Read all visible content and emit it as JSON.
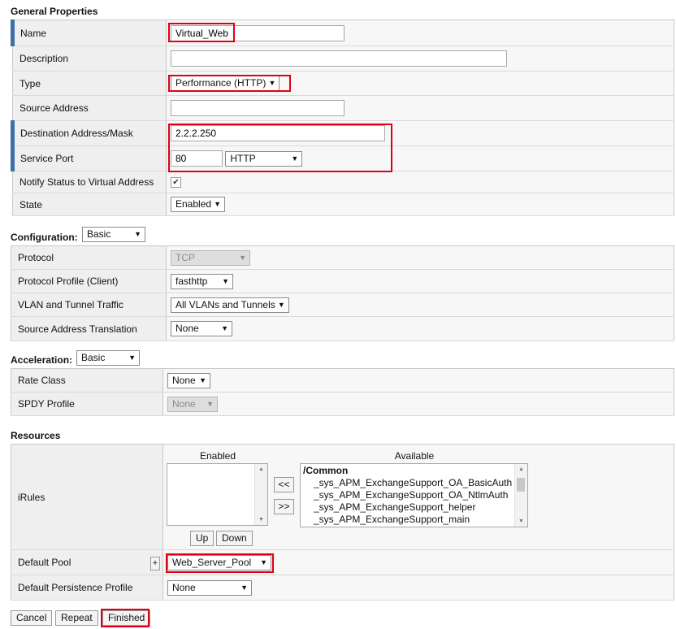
{
  "general": {
    "title": "General Properties",
    "name_label": "Name",
    "name_value": "Virtual_Web",
    "description_label": "Description",
    "description_value": "",
    "type_label": "Type",
    "type_value": "Performance (HTTP)",
    "source_label": "Source Address",
    "source_value": "",
    "dest_label": "Destination Address/Mask",
    "dest_value": "2.2.2.250",
    "port_label": "Service Port",
    "port_value": "80",
    "port_service": "HTTP",
    "notify_label": "Notify Status to Virtual Address",
    "notify_checked": "✔",
    "state_label": "State",
    "state_value": "Enabled"
  },
  "configuration": {
    "title": "Configuration:",
    "mode": "Basic",
    "protocol_label": "Protocol",
    "protocol_value": "TCP",
    "profile_label": "Protocol Profile (Client)",
    "profile_value": "fasthttp",
    "vlan_label": "VLAN and Tunnel Traffic",
    "vlan_value": "All VLANs and Tunnels",
    "snat_label": "Source Address Translation",
    "snat_value": "None"
  },
  "acceleration": {
    "title": "Acceleration:",
    "mode": "Basic",
    "rate_label": "Rate Class",
    "rate_value": "None",
    "spdy_label": "SPDY Profile",
    "spdy_value": "None"
  },
  "resources": {
    "title": "Resources",
    "irules_label": "iRules",
    "enabled_header": "Enabled",
    "available_header": "Available",
    "move_left": "<<",
    "move_right": ">>",
    "up_label": "Up",
    "down_label": "Down",
    "available_items": [
      "/Common",
      "_sys_APM_ExchangeSupport_OA_BasicAuth",
      "_sys_APM_ExchangeSupport_OA_NtlmAuth",
      "_sys_APM_ExchangeSupport_helper",
      "_sys_APM_ExchangeSupport_main"
    ],
    "pool_label": "Default Pool",
    "pool_add": "+",
    "pool_value": "Web_Server_Pool",
    "persistence_label": "Default Persistence Profile",
    "persistence_value": "None"
  },
  "actions": {
    "cancel": "Cancel",
    "repeat": "Repeat",
    "finished": "Finished"
  },
  "colors": {
    "highlight": "#e00016",
    "required_bar": "#3e6fa8"
  }
}
